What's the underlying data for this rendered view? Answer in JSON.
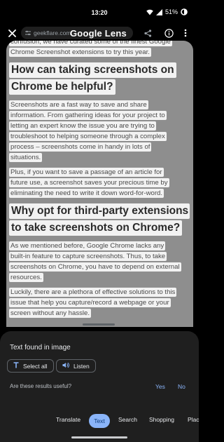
{
  "status": {
    "time": "13:20",
    "battery": "51%"
  },
  "header": {
    "title": "Google Lens",
    "url": "geekflare.com"
  },
  "capture": {
    "lines": [
      {
        "kind": "p",
        "text": "confusion, we have curated some of the finest Google"
      },
      {
        "kind": "p",
        "text": "Chrome Screenshot extensions to try this year."
      },
      {
        "kind": "gap"
      },
      {
        "kind": "h",
        "text": "How can taking screenshots on"
      },
      {
        "kind": "h",
        "text": "Chrome be helpful?"
      },
      {
        "kind": "gap"
      },
      {
        "kind": "p",
        "text": "Screenshots are a fast way to save and share"
      },
      {
        "kind": "p",
        "text": "information. From gathering ideas for your project to"
      },
      {
        "kind": "p",
        "text": "letting an expert know the issue you are trying to"
      },
      {
        "kind": "p",
        "text": "troubleshoot to helping someone through a complex"
      },
      {
        "kind": "p",
        "text": "process – screenshots come in handy in lots of"
      },
      {
        "kind": "p",
        "text": "situations."
      },
      {
        "kind": "gap"
      },
      {
        "kind": "p",
        "text": "Plus, if you want to save a passage of an article for"
      },
      {
        "kind": "p",
        "text": "future use, a screenshot saves your precious time by"
      },
      {
        "kind": "p",
        "text": "eliminating the need to write it down word-for-word."
      },
      {
        "kind": "gap"
      },
      {
        "kind": "h",
        "text": "Why opt for third-party extensions"
      },
      {
        "kind": "h",
        "text": "to take screenshots on Chrome?"
      },
      {
        "kind": "gap"
      },
      {
        "kind": "p",
        "text": "As we mentioned before, Google Chrome lacks any"
      },
      {
        "kind": "p",
        "text": "built-in feature to capture screenshots. Thus, to take"
      },
      {
        "kind": "p",
        "text": "screenshots on Chrome, you have to depend on external"
      },
      {
        "kind": "p",
        "text": "resources."
      },
      {
        "kind": "gap"
      },
      {
        "kind": "p",
        "text": "Luckily, there are a plethora of effective solutions to this"
      },
      {
        "kind": "p",
        "text": "issue that help you capture/record a webpage or your"
      },
      {
        "kind": "p",
        "text": "screen without any hassle."
      }
    ]
  },
  "sheet": {
    "title": "Text found in image",
    "select_all": "Select all",
    "listen": "Listen",
    "useful_question": "Are these results useful?",
    "yes": "Yes",
    "no": "No"
  },
  "tabs": [
    "Translate",
    "Text",
    "Search",
    "Shopping",
    "Plac"
  ],
  "colors": {
    "accent": "#8ab4f8",
    "sheet_bg": "#1f1f1f",
    "capture_bg": "#8e8e8e"
  },
  "icons": [
    "close-icon",
    "share-icon",
    "info-icon",
    "more-vert-icon",
    "text-icon",
    "listen-icon",
    "wifi-icon",
    "signal-icon",
    "battery-icon"
  ]
}
